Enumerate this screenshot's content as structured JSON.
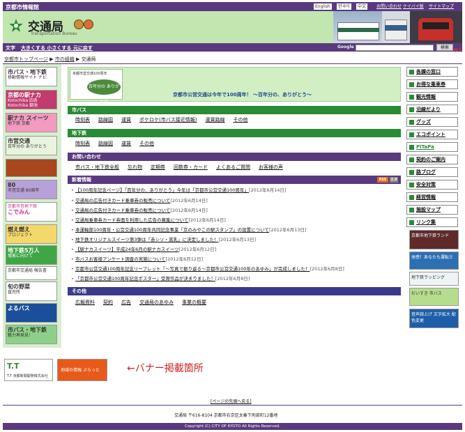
{
  "topbar": {
    "site_name": "京都市情報館",
    "lang_en": "English",
    "lang_ko": "한국어",
    "lang_zh": "中文",
    "inquiry": "お問い合わせ",
    "mobile": "ケイバイ版",
    "sitemap": "サイトマップ"
  },
  "header": {
    "title": "交通局",
    "subtitle": "Transportation Bureau"
  },
  "subbar": {
    "text_label": "文字",
    "font_sizes": "大きくする 小さくする 元に戻す",
    "google_label": "Google",
    "search_button": "検索"
  },
  "breadcrumb": {
    "home": "京都市トップページ",
    "org": "市の組織",
    "current": "交通局"
  },
  "left_banners": [
    {
      "title": "市バス・地下鉄",
      "sub": "移動情報サイト ナビ"
    },
    {
      "title": "京都の駅ナカ",
      "sub": "Kotochika 四条 Kotochika 御池"
    },
    {
      "title": "駅ナカ スイーツ",
      "sub": "地下鉄 京都"
    },
    {
      "title": "市営交通",
      "sub": "百年分の ありがとう"
    },
    {
      "title": "",
      "sub": ""
    },
    {
      "title": "80",
      "sub": "市営交通 80周年"
    },
    {
      "title": "こでみん",
      "sub": "京都市営地下鉄"
    },
    {
      "title": "燃え燃え",
      "sub": "プロジェクト"
    },
    {
      "title": "地下鉄5万人",
      "sub": "増客に向けて"
    },
    {
      "title": "",
      "sub": "京都市交通局 報告書"
    },
    {
      "title": "旬の野菜",
      "sub": "直売所"
    },
    {
      "title": "よるバス",
      "sub": ""
    },
    {
      "title": "市バス・地下鉄",
      "sub": "魅力再発見！"
    }
  ],
  "main": {
    "banner_mini_top": "京都市営交通100周年",
    "banner_mini_oval": "百年分の ありがとう",
    "banner_text": "京都市公営交通は今年で100周年！ ～百年分の、ありがとう～",
    "sections": {
      "bus": {
        "title": "市バス",
        "links": [
          "時刻表",
          "路線図",
          "運賃",
          "ポケロケ(市バス接近情報)",
          "運賃路線",
          "その他"
        ]
      },
      "subway": {
        "title": "地下鉄",
        "links": [
          "時刻表",
          "路線図",
          "運賃",
          "その他"
        ]
      },
      "contact": {
        "title": "お問い合わせ",
        "links": [
          "市バス・地下鉄全般",
          "忘れ物",
          "定期券",
          "回数券・カード",
          "よくあるご質問",
          "お客様の声"
        ]
      },
      "news": {
        "title": "新着情報",
        "rss": "RSS",
        "rss2": "2.0",
        "items": [
          {
            "t": "【100周年記念ページ】「百年分の、ありがとう」今年は「京都市公営交通100周年」",
            "d": "[2012年6月14日]"
          },
          {
            "t": "交通局の広告付きカード乗車券の販売について",
            "d": "[2012年6月14日]"
          },
          {
            "t": "交通局の広告付きカード乗車券の販売について",
            "d": "[2012年6月14日]"
          },
          {
            "t": "交通局乗車券カード券面を利用した広告の募集について",
            "d": "[2012年6月14日]"
          },
          {
            "t": "本運輸部100周年・公営交通100周年共同記念事業「京のみやこの駅スタンプ」の設置について",
            "d": "[2012年6月13日]"
          },
          {
            "t": "地下鉄オリジナルスイーツ第3弾は「赤シソ・黒乳」に決定しました！",
            "d": "[2012年6月13日]"
          },
          {
            "t": "【駅ナカスイーツ】平成24年6月の駅ナカスイーツ",
            "d": "[2012年6月12日]"
          },
          {
            "t": "市バスお客様アンケート調査の実施について",
            "d": "[2012年6月12日]"
          },
          {
            "t": "京都市公営交通100周年記念リーフレット「～写真で振り返る～京都市公営交通100年のあゆみ」が完成しました！",
            "d": "[2012年6月8日]"
          },
          {
            "t": "「京都市公営交通100周年記念ポスター」受賞作品が決まりました！",
            "d": "[2012年6月8日]"
          }
        ]
      },
      "other": {
        "title": "その他",
        "links": [
          "広報資料",
          "契約",
          "広告",
          "交通局のあゆみ",
          "事業の概要"
        ]
      }
    }
  },
  "right_nav": [
    "各課の窓口",
    "お得な乗車券",
    "観光情報",
    "沿線だより",
    "グッズ",
    "エコポイント",
    "PiTaPa",
    "契約のご案内",
    "路ブログ",
    "安全対策",
    "経営情報",
    "施設マップ",
    "リンク集"
  ],
  "right_images": [
    {
      "label": "京都市地下鉄ランド"
    },
    {
      "label": "体感！あなたも運転士"
    },
    {
      "label": "地下鉄ラッピング"
    },
    {
      "label": "だいすき 市バス"
    },
    {
      "label": "音声読上げ 文字拡大 配色変更"
    }
  ],
  "bottom": {
    "banner1": "T.T 京都新聞開発株式会社",
    "banner2": "地域の情報 ぷらっと",
    "arrow_text": "←バナー掲載箇所",
    "back_to_top": "[ページの先頭へ戻る]",
    "address": "交通局 〒616-8104 京都市右京区太秦下刑部町12番地",
    "copyright": "Copyright (C) CITY OF KYOTO All Rights Reserved."
  }
}
